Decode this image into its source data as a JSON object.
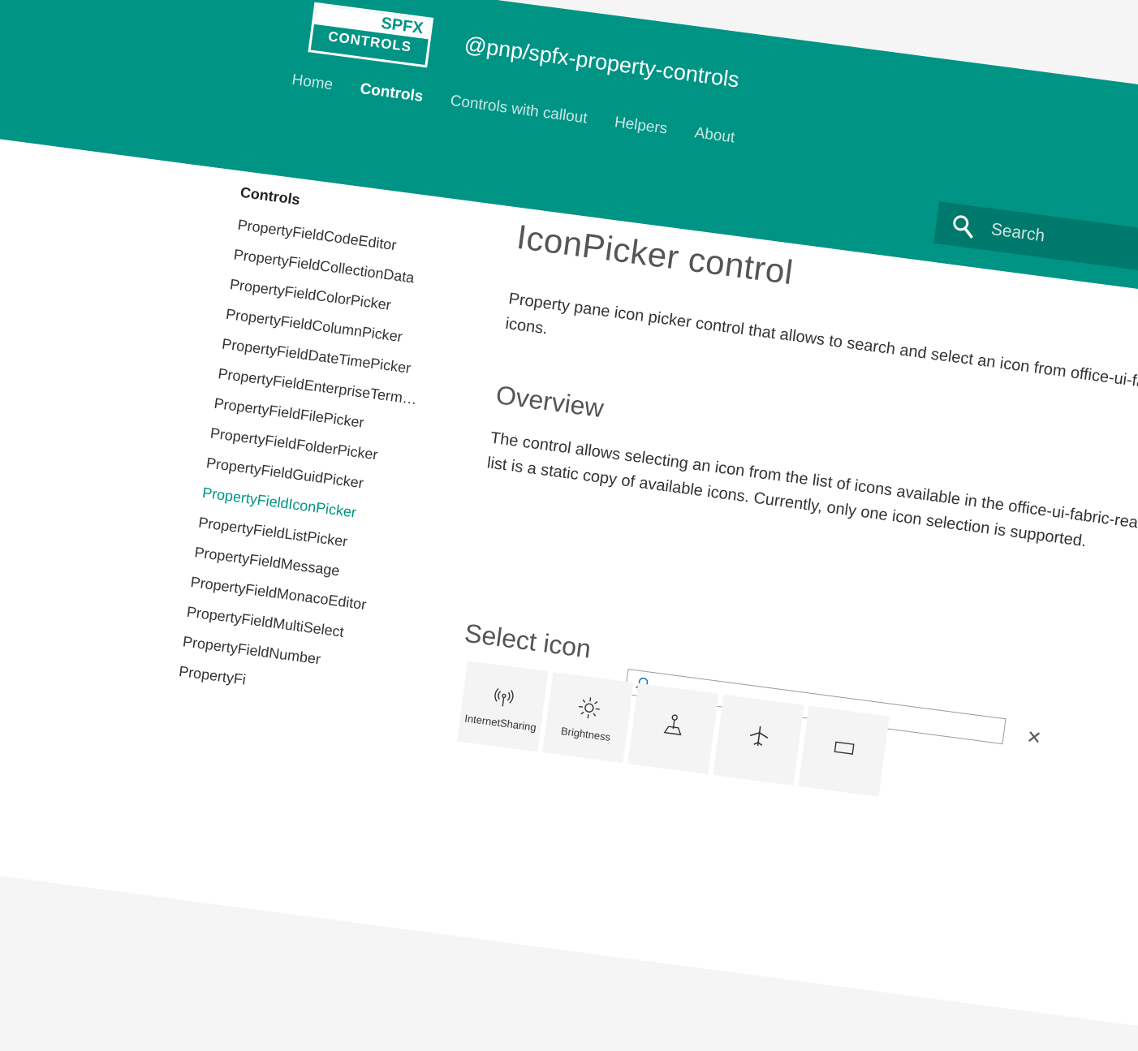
{
  "header": {
    "logo_top": "SPFX",
    "logo_bottom": "CONTROLS",
    "site_title": "@pnp/spfx-property-controls",
    "nav": [
      {
        "label": "Home",
        "active": false
      },
      {
        "label": "Controls",
        "active": true
      },
      {
        "label": "Controls with callout",
        "active": false
      },
      {
        "label": "Helpers",
        "active": false
      },
      {
        "label": "About",
        "active": false
      }
    ],
    "search_placeholder": "Search"
  },
  "sidebar": {
    "title": "Controls",
    "items": [
      {
        "label": "PropertyFieldCodeEditor"
      },
      {
        "label": "PropertyFieldCollectionData"
      },
      {
        "label": "PropertyFieldColorPicker"
      },
      {
        "label": "PropertyFieldColumnPicker"
      },
      {
        "label": "PropertyFieldDateTimePicker"
      },
      {
        "label": "PropertyFieldEnterpriseTermPic..."
      },
      {
        "label": "PropertyFieldFilePicker"
      },
      {
        "label": "PropertyFieldFolderPicker"
      },
      {
        "label": "PropertyFieldGuidPicker"
      },
      {
        "label": "PropertyFieldIconPicker",
        "active": true
      },
      {
        "label": "PropertyFieldListPicker"
      },
      {
        "label": "PropertyFieldMessage"
      },
      {
        "label": "PropertyFieldMonacoEditor"
      },
      {
        "label": "PropertyFieldMultiSelect"
      },
      {
        "label": "PropertyFieldNumber"
      },
      {
        "label": "PropertyFi"
      }
    ]
  },
  "main": {
    "title": "IconPicker control",
    "intro": "Property pane icon picker control that allows to search and select an icon from office-ui-fabric-react icons.",
    "overview_heading": "Overview",
    "overview_text": "The control allows selecting an icon from the list of icons available in the office-ui-fabric-react library. Icon list is a static copy of available icons. Currently, only one icon selection is supported."
  },
  "picker": {
    "title": "Select icon",
    "close_symbol": "✕",
    "icons": [
      {
        "label": "InternetSharing",
        "icon": "internet-sharing-icon"
      },
      {
        "label": "Brightness",
        "icon": "brightness-icon"
      },
      {
        "label": "",
        "icon": "map-pin-icon"
      },
      {
        "label": "",
        "icon": "airplane-icon"
      },
      {
        "label": "",
        "icon": "rectangle-icon"
      }
    ]
  },
  "colors": {
    "accent": "#009485",
    "search_bg": "#00796d"
  }
}
